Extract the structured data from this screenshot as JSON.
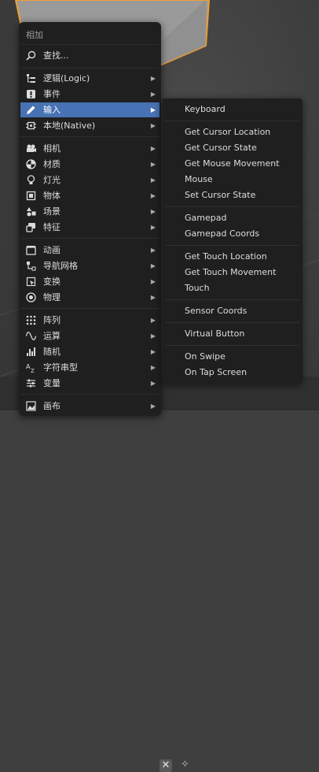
{
  "menu": {
    "title": "相加",
    "search_label": "查找...",
    "items": [
      {
        "label": "逻辑(Logic)",
        "icon": "logic-icon"
      },
      {
        "label": "事件",
        "icon": "event-icon"
      },
      {
        "label": "输入",
        "icon": "pencil-icon"
      },
      {
        "label": "本地(Native)",
        "icon": "native-icon"
      },
      {
        "label": "相机",
        "icon": "camera-icon"
      },
      {
        "label": "材质",
        "icon": "material-icon"
      },
      {
        "label": "灯光",
        "icon": "light-icon"
      },
      {
        "label": "物体",
        "icon": "object-icon"
      },
      {
        "label": "场景",
        "icon": "scene-icon"
      },
      {
        "label": "特征",
        "icon": "trait-icon"
      },
      {
        "label": "动画",
        "icon": "animation-icon"
      },
      {
        "label": "导航网格",
        "icon": "navmesh-icon"
      },
      {
        "label": "变换",
        "icon": "transform-icon"
      },
      {
        "label": "物理",
        "icon": "physics-icon"
      },
      {
        "label": "阵列",
        "icon": "array-icon"
      },
      {
        "label": "运算",
        "icon": "math-icon"
      },
      {
        "label": "随机",
        "icon": "random-icon"
      },
      {
        "label": "字符串型",
        "icon": "string-icon"
      },
      {
        "label": "变量",
        "icon": "variable-icon"
      },
      {
        "label": "画布",
        "icon": "canvas-icon"
      }
    ]
  },
  "submenu": {
    "items": [
      "Keyboard",
      "Get Cursor Location",
      "Get Cursor State",
      "Get Mouse Movement",
      "Mouse",
      "Set Cursor State",
      "Gamepad",
      "Gamepad Coords",
      "Get Touch Location",
      "Get Touch Movement",
      "Touch",
      "Sensor Coords",
      "Virtual Button",
      "On Swipe",
      "On Tap Screen"
    ]
  },
  "statusbar": {
    "close_symbol": "✕",
    "pin_symbol": "✧"
  },
  "colors": {
    "accent": "#4772b3",
    "menu_bg": "#1f1f1f",
    "object_outline": "#f29d35"
  }
}
